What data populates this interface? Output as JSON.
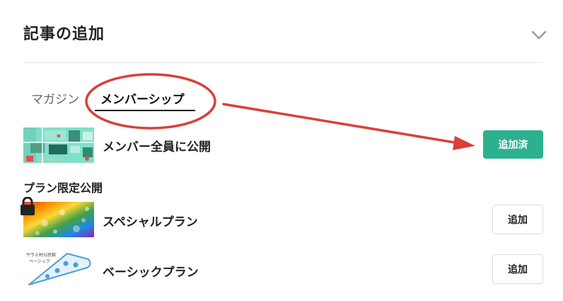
{
  "panel": {
    "title": "記事の追加"
  },
  "tabs": [
    {
      "label": "マガジン",
      "active": false
    },
    {
      "label": "メンバーシップ",
      "active": true
    }
  ],
  "all_members": {
    "label": "メンバー全員に公開",
    "button_label": "追加済",
    "button_color": "#2bb18e"
  },
  "plan_section": {
    "heading": "プラン限定公開"
  },
  "plans": [
    {
      "name": "スペシャルプラン",
      "button_label": "追加"
    },
    {
      "name": "ベーシックプラン",
      "button_label": "追加",
      "thumb_caption": [
        "サラミ村公民館",
        "ベーシック"
      ]
    }
  ],
  "icons": {
    "collapse": "chevron-down-icon",
    "lock": "lock-icon",
    "annotation": "red-circle-arrow-annotation"
  },
  "colors": {
    "accent": "#2bb18e",
    "annotation": "#d9403a"
  }
}
